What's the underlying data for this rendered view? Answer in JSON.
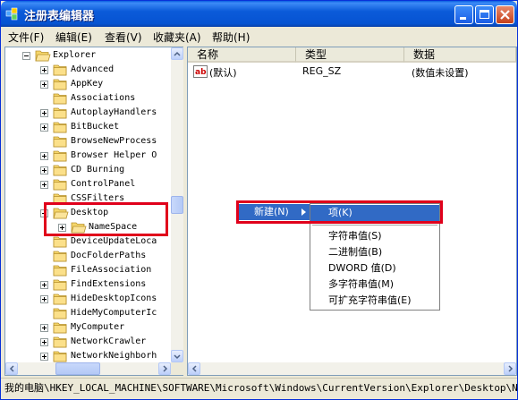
{
  "window": {
    "title": "注册表编辑器"
  },
  "menu": [
    "文件(F)",
    "编辑(E)",
    "查看(V)",
    "收藏夹(A)",
    "帮助(H)"
  ],
  "tree": [
    {
      "label": "Explorer",
      "expander": "minus",
      "indent": 0
    },
    {
      "label": "Advanced",
      "expander": "plus",
      "indent": 1
    },
    {
      "label": "AppKey",
      "expander": "plus",
      "indent": 1
    },
    {
      "label": "Associations",
      "expander": "none",
      "indent": 1
    },
    {
      "label": "AutoplayHandlers",
      "expander": "plus",
      "indent": 1
    },
    {
      "label": "BitBucket",
      "expander": "plus",
      "indent": 1
    },
    {
      "label": "BrowseNewProcess",
      "expander": "none",
      "indent": 1
    },
    {
      "label": "Browser Helper O",
      "expander": "plus",
      "indent": 1
    },
    {
      "label": "CD Burning",
      "expander": "plus",
      "indent": 1
    },
    {
      "label": "ControlPanel",
      "expander": "plus",
      "indent": 1
    },
    {
      "label": "CSSFilters",
      "expander": "none",
      "indent": 1
    },
    {
      "label": "Desktop",
      "expander": "minus",
      "indent": 1
    },
    {
      "label": "NameSpace",
      "expander": "plus",
      "indent": 2,
      "selected": true
    },
    {
      "label": "DeviceUpdateLoca",
      "expander": "none",
      "indent": 1
    },
    {
      "label": "DocFolderPaths",
      "expander": "none",
      "indent": 1
    },
    {
      "label": "FileAssociation",
      "expander": "none",
      "indent": 1
    },
    {
      "label": "FindExtensions",
      "expander": "plus",
      "indent": 1
    },
    {
      "label": "HideDesktopIcons",
      "expander": "plus",
      "indent": 1
    },
    {
      "label": "HideMyComputerIc",
      "expander": "none",
      "indent": 1
    },
    {
      "label": "MyComputer",
      "expander": "plus",
      "indent": 1
    },
    {
      "label": "NetworkCrawler",
      "expander": "plus",
      "indent": 1
    },
    {
      "label": "NetworkNeighborh",
      "expander": "plus",
      "indent": 1
    }
  ],
  "list": {
    "columns": [
      "名称",
      "类型",
      "数据"
    ],
    "rows": [
      {
        "name": "(默认)",
        "type": "REG_SZ",
        "data": "(数值未设置)",
        "icon": "ab-icon"
      }
    ]
  },
  "context_menu": {
    "new_label": "新建(N)",
    "submenu": [
      "项(K)",
      "字符串值(S)",
      "二进制值(B)",
      "DWORD 值(D)",
      "多字符串值(M)",
      "可扩充字符串值(E)"
    ]
  },
  "statusbar": "我的电脑\\HKEY_LOCAL_MACHINE\\SOFTWARE\\Microsoft\\Windows\\CurrentVersion\\Explorer\\Desktop\\NameSpace"
}
